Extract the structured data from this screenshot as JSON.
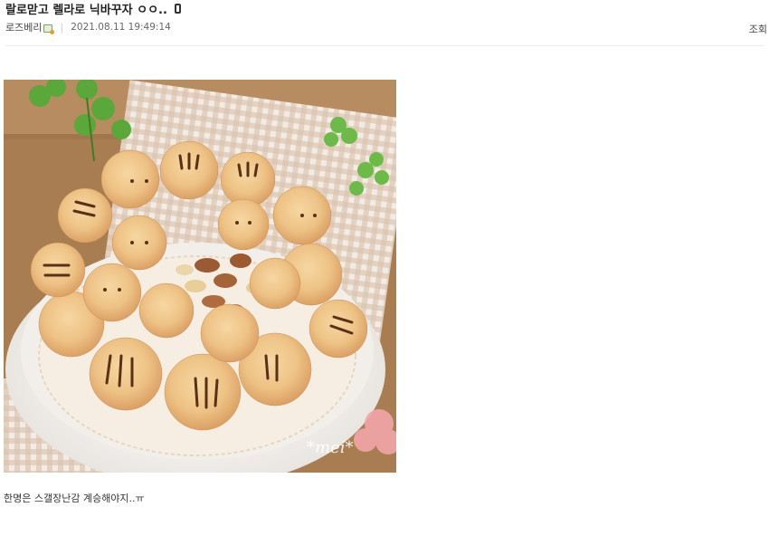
{
  "post": {
    "title": "랄로맏고 렐라로 닉바꾸자 ㅇㅇ..",
    "author": "로즈베리",
    "datetime": "2021.08.11 19:49:14",
    "views_label": "조회",
    "body": "한명은 스갤장난감 계승해야지..ㅠ"
  },
  "photo": {
    "watermark": "*mei*"
  },
  "icons": {
    "title_device": "mobile-icon",
    "author_badge": "member-badge-icon"
  },
  "colors": {
    "title": "#222222",
    "meta_text": "#666666",
    "divider": "#ececec"
  }
}
